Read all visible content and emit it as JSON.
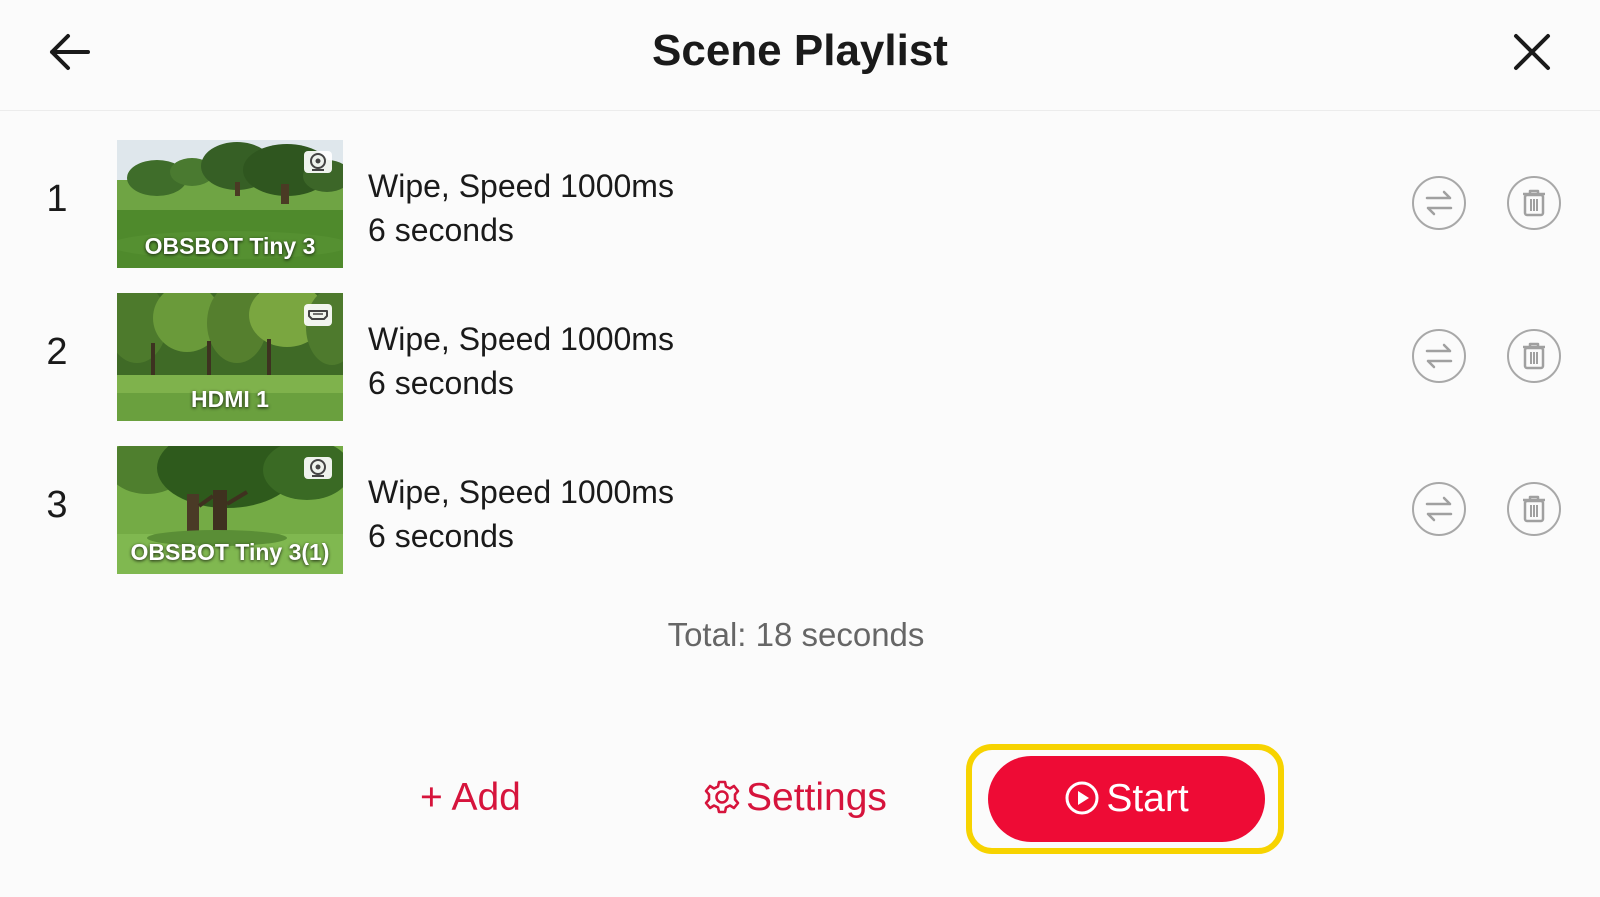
{
  "header": {
    "title": "Scene Playlist",
    "back_icon": "arrow-left-icon",
    "close_icon": "close-icon"
  },
  "playlist": {
    "items": [
      {
        "index": "1",
        "thumbnail_label": "OBSBOT Tiny 3",
        "source_icon": "webcam-icon",
        "transition": "Wipe, Speed 1000ms",
        "duration": "6 seconds"
      },
      {
        "index": "2",
        "thumbnail_label": "HDMI 1",
        "source_icon": "hdmi-icon",
        "transition": "Wipe, Speed 1000ms",
        "duration": "6 seconds"
      },
      {
        "index": "3",
        "thumbnail_label": "OBSBOT Tiny 3(1)",
        "source_icon": "webcam-icon",
        "transition": "Wipe, Speed 1000ms",
        "duration": "6 seconds"
      }
    ],
    "row_action_icons": [
      "swap-icon",
      "trash-icon"
    ]
  },
  "total": "Total: 18 seconds",
  "footer": {
    "add_label": "+ Add",
    "settings_label": "Settings",
    "start_label": "Start"
  },
  "colors": {
    "accent": "#ee0b35",
    "accent_text": "#d6143c",
    "highlight": "#f7d300",
    "background": "#fbfbfb"
  }
}
